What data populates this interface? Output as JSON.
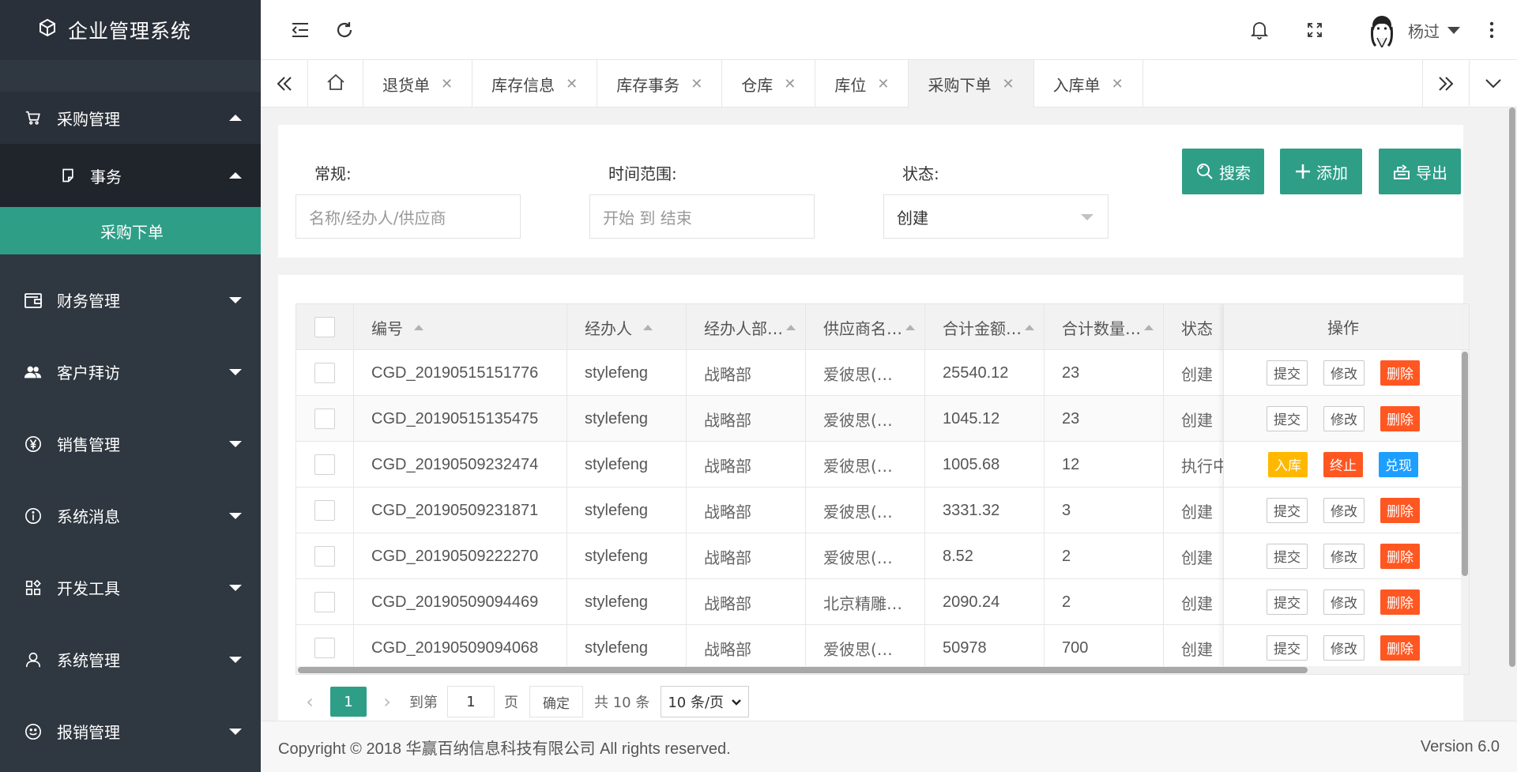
{
  "app": {
    "title": "企业管理系统"
  },
  "colors": {
    "accent": "#2e9e87",
    "sidebar": "#2f3740",
    "danger": "#ff5722",
    "warn": "#ffb800",
    "normal": "#1e9fff"
  },
  "sidebar": {
    "items": [
      {
        "label": "采购管理",
        "icon": "cart-icon",
        "open": true
      },
      {
        "label": "财务管理",
        "icon": "wallet-icon"
      },
      {
        "label": "客户拜访",
        "icon": "users-icon"
      },
      {
        "label": "销售管理",
        "icon": "yen-icon"
      },
      {
        "label": "系统消息",
        "icon": "info-icon"
      },
      {
        "label": "开发工具",
        "icon": "apps-icon"
      },
      {
        "label": "系统管理",
        "icon": "user-icon"
      },
      {
        "label": "报销管理",
        "icon": "smile-icon"
      }
    ],
    "sub": {
      "label": "事务",
      "active_item": "采购下单"
    }
  },
  "header": {
    "username": "杨过"
  },
  "tabs": [
    {
      "label": "退货单"
    },
    {
      "label": "库存信息"
    },
    {
      "label": "库存事务"
    },
    {
      "label": "仓库"
    },
    {
      "label": "库位"
    },
    {
      "label": "采购下单",
      "active": true
    },
    {
      "label": "入库单"
    }
  ],
  "search": {
    "general_label": "常规:",
    "general_placeholder": "名称/经办人/供应商",
    "time_label": "时间范围:",
    "time_placeholder": "开始 到 结束",
    "status_label": "状态:",
    "status_value": "创建",
    "search_btn": "搜索",
    "add_btn": "添加",
    "export_btn": "导出"
  },
  "table": {
    "headers": {
      "code": "编号",
      "handler": "经办人",
      "dept": "经办人部…",
      "supplier": "供应商名…",
      "amount": "合计金额…",
      "qty": "合计数量…",
      "status": "状态",
      "ops": "操作"
    },
    "rows": [
      {
        "code": "CGD_20190515151776",
        "handler": "stylefeng",
        "dept": "战略部",
        "supplier": "爱彼思(…",
        "amount": "25540.12",
        "qty": "23",
        "status": "创建",
        "ops": [
          "提交",
          "修改",
          "删除"
        ]
      },
      {
        "code": "CGD_20190515135475",
        "handler": "stylefeng",
        "dept": "战略部",
        "supplier": "爱彼思(…",
        "amount": "1045.12",
        "qty": "23",
        "status": "创建",
        "ops": [
          "提交",
          "修改",
          "删除"
        ]
      },
      {
        "code": "CGD_20190509232474",
        "handler": "stylefeng",
        "dept": "战略部",
        "supplier": "爱彼思(…",
        "amount": "1005.68",
        "qty": "12",
        "status": "执行中",
        "ops": [
          "入库",
          "终止",
          "兑现"
        ]
      },
      {
        "code": "CGD_20190509231871",
        "handler": "stylefeng",
        "dept": "战略部",
        "supplier": "爱彼思(…",
        "amount": "3331.32",
        "qty": "3",
        "status": "创建",
        "ops": [
          "提交",
          "修改",
          "删除"
        ]
      },
      {
        "code": "CGD_20190509222270",
        "handler": "stylefeng",
        "dept": "战略部",
        "supplier": "爱彼思(…",
        "amount": "8.52",
        "qty": "2",
        "status": "创建",
        "ops": [
          "提交",
          "修改",
          "删除"
        ]
      },
      {
        "code": "CGD_20190509094469",
        "handler": "stylefeng",
        "dept": "战略部",
        "supplier": "北京精雕…",
        "amount": "2090.24",
        "qty": "2",
        "status": "创建",
        "ops": [
          "提交",
          "修改",
          "删除"
        ]
      },
      {
        "code": "CGD_20190509094068",
        "handler": "stylefeng",
        "dept": "战略部",
        "supplier": "爱彼思(…",
        "amount": "50978",
        "qty": "700",
        "status": "创建",
        "ops": [
          "提交",
          "修改",
          "删除"
        ]
      }
    ]
  },
  "pager": {
    "current": "1",
    "goto_label": "到第",
    "goto_value": "1",
    "page_unit": "页",
    "confirm": "确定",
    "total": "共 10 条",
    "page_size": "10 条/页"
  },
  "footer": {
    "copyright_prefix": "Copyright © 2018",
    "company": "华赢百纳信息科技有限公司",
    "rights": "All rights reserved.",
    "version": "Version 6.0"
  }
}
